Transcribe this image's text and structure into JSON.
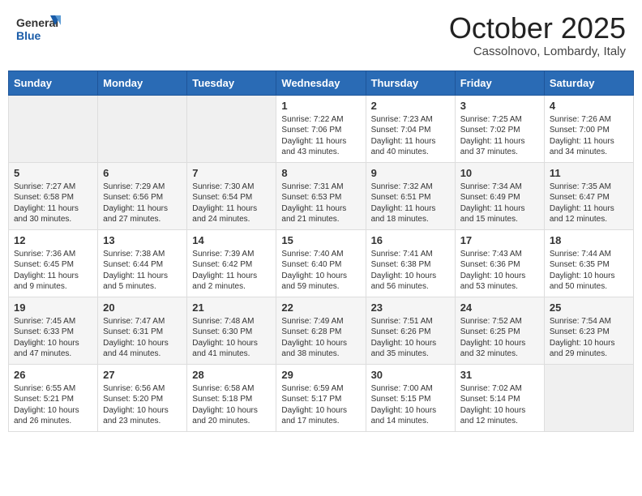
{
  "header": {
    "logo_general": "General",
    "logo_blue": "Blue",
    "month_title": "October 2025",
    "location": "Cassolnovo, Lombardy, Italy"
  },
  "days_of_week": [
    "Sunday",
    "Monday",
    "Tuesday",
    "Wednesday",
    "Thursday",
    "Friday",
    "Saturday"
  ],
  "weeks": [
    [
      {
        "day": "",
        "content": ""
      },
      {
        "day": "",
        "content": ""
      },
      {
        "day": "",
        "content": ""
      },
      {
        "day": "1",
        "content": "Sunrise: 7:22 AM\nSunset: 7:06 PM\nDaylight: 11 hours and 43 minutes."
      },
      {
        "day": "2",
        "content": "Sunrise: 7:23 AM\nSunset: 7:04 PM\nDaylight: 11 hours and 40 minutes."
      },
      {
        "day": "3",
        "content": "Sunrise: 7:25 AM\nSunset: 7:02 PM\nDaylight: 11 hours and 37 minutes."
      },
      {
        "day": "4",
        "content": "Sunrise: 7:26 AM\nSunset: 7:00 PM\nDaylight: 11 hours and 34 minutes."
      }
    ],
    [
      {
        "day": "5",
        "content": "Sunrise: 7:27 AM\nSunset: 6:58 PM\nDaylight: 11 hours and 30 minutes."
      },
      {
        "day": "6",
        "content": "Sunrise: 7:29 AM\nSunset: 6:56 PM\nDaylight: 11 hours and 27 minutes."
      },
      {
        "day": "7",
        "content": "Sunrise: 7:30 AM\nSunset: 6:54 PM\nDaylight: 11 hours and 24 minutes."
      },
      {
        "day": "8",
        "content": "Sunrise: 7:31 AM\nSunset: 6:53 PM\nDaylight: 11 hours and 21 minutes."
      },
      {
        "day": "9",
        "content": "Sunrise: 7:32 AM\nSunset: 6:51 PM\nDaylight: 11 hours and 18 minutes."
      },
      {
        "day": "10",
        "content": "Sunrise: 7:34 AM\nSunset: 6:49 PM\nDaylight: 11 hours and 15 minutes."
      },
      {
        "day": "11",
        "content": "Sunrise: 7:35 AM\nSunset: 6:47 PM\nDaylight: 11 hours and 12 minutes."
      }
    ],
    [
      {
        "day": "12",
        "content": "Sunrise: 7:36 AM\nSunset: 6:45 PM\nDaylight: 11 hours and 9 minutes."
      },
      {
        "day": "13",
        "content": "Sunrise: 7:38 AM\nSunset: 6:44 PM\nDaylight: 11 hours and 5 minutes."
      },
      {
        "day": "14",
        "content": "Sunrise: 7:39 AM\nSunset: 6:42 PM\nDaylight: 11 hours and 2 minutes."
      },
      {
        "day": "15",
        "content": "Sunrise: 7:40 AM\nSunset: 6:40 PM\nDaylight: 10 hours and 59 minutes."
      },
      {
        "day": "16",
        "content": "Sunrise: 7:41 AM\nSunset: 6:38 PM\nDaylight: 10 hours and 56 minutes."
      },
      {
        "day": "17",
        "content": "Sunrise: 7:43 AM\nSunset: 6:36 PM\nDaylight: 10 hours and 53 minutes."
      },
      {
        "day": "18",
        "content": "Sunrise: 7:44 AM\nSunset: 6:35 PM\nDaylight: 10 hours and 50 minutes."
      }
    ],
    [
      {
        "day": "19",
        "content": "Sunrise: 7:45 AM\nSunset: 6:33 PM\nDaylight: 10 hours and 47 minutes."
      },
      {
        "day": "20",
        "content": "Sunrise: 7:47 AM\nSunset: 6:31 PM\nDaylight: 10 hours and 44 minutes."
      },
      {
        "day": "21",
        "content": "Sunrise: 7:48 AM\nSunset: 6:30 PM\nDaylight: 10 hours and 41 minutes."
      },
      {
        "day": "22",
        "content": "Sunrise: 7:49 AM\nSunset: 6:28 PM\nDaylight: 10 hours and 38 minutes."
      },
      {
        "day": "23",
        "content": "Sunrise: 7:51 AM\nSunset: 6:26 PM\nDaylight: 10 hours and 35 minutes."
      },
      {
        "day": "24",
        "content": "Sunrise: 7:52 AM\nSunset: 6:25 PM\nDaylight: 10 hours and 32 minutes."
      },
      {
        "day": "25",
        "content": "Sunrise: 7:54 AM\nSunset: 6:23 PM\nDaylight: 10 hours and 29 minutes."
      }
    ],
    [
      {
        "day": "26",
        "content": "Sunrise: 6:55 AM\nSunset: 5:21 PM\nDaylight: 10 hours and 26 minutes."
      },
      {
        "day": "27",
        "content": "Sunrise: 6:56 AM\nSunset: 5:20 PM\nDaylight: 10 hours and 23 minutes."
      },
      {
        "day": "28",
        "content": "Sunrise: 6:58 AM\nSunset: 5:18 PM\nDaylight: 10 hours and 20 minutes."
      },
      {
        "day": "29",
        "content": "Sunrise: 6:59 AM\nSunset: 5:17 PM\nDaylight: 10 hours and 17 minutes."
      },
      {
        "day": "30",
        "content": "Sunrise: 7:00 AM\nSunset: 5:15 PM\nDaylight: 10 hours and 14 minutes."
      },
      {
        "day": "31",
        "content": "Sunrise: 7:02 AM\nSunset: 5:14 PM\nDaylight: 10 hours and 12 minutes."
      },
      {
        "day": "",
        "content": ""
      }
    ]
  ]
}
